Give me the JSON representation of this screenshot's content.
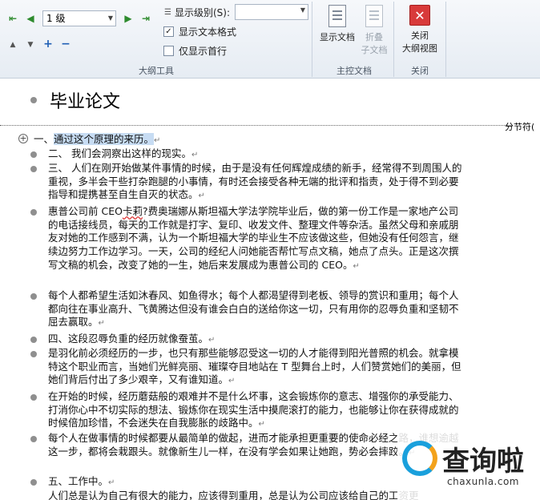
{
  "ribbon": {
    "outline_tools": {
      "group_label": "大纲工具",
      "level_select_value": "1 级",
      "show_level_label": "显示级别(S):",
      "show_text_format_label": "显示文本格式",
      "show_text_format_checked": true,
      "show_first_line_label": "仅显示首行",
      "show_first_line_checked": false
    },
    "master_document": {
      "group_label": "主控文档",
      "show_document_label": "显示文档",
      "collapse_subdoc_label_1": "折叠",
      "collapse_subdoc_label_2": "子文档"
    },
    "close": {
      "group_label": "关闭",
      "close_label_1": "关闭",
      "close_label_2": "大纲视图"
    }
  },
  "document": {
    "title": "毕业论文",
    "section_break_label": "分节符(",
    "paragraphs": [
      {
        "pre": "一、",
        "highlighted": "通过这个原理的来历。",
        "post": ""
      },
      {
        "text": "二、     我们会洞察出这样的现实。"
      },
      {
        "text": "三、     人们在刚开始做某件事情的时候，由于是没有任何辉煌成绩的新手，经常得不到周围人的重视，多半会干些打杂跑腿的小事情，有时还会接受各种无端的批评和指责，处于得不到必要指导和提携甚至自生自灭的状态。"
      },
      {
        "pre": "惠普公司前 CEO",
        "squiggle": "卡莉",
        "post": "?费奥瑞娜从斯坦福大学法学院毕业后，做的第一份工作是一家地产公司的电话接线员，每天的工作就是打字、复印、收发文件、整理文件等杂活。虽然父母和亲戚朋友对她的工作感到不满，认为一个斯坦福大学的毕业生不应该做这些，但她没有任何怨言，继续边努力工作边学习。一天，公司的经纪人问她能否帮忙写点文稿，她点了点头。正是这次撰写文稿的机会，改变了她的一生，她后来发展成为惠普公司的 CEO。"
      },
      {
        "text": "每个人都希望生活如沐春风、如鱼得水；每个人都渴望得到老板、领导的赏识和重用；每个人都向往在事业高升、飞黄腾达但没有谁会白白的送给你这一切，只有用你的忍辱负重和坚韧不屈去赢取。"
      },
      {
        "text": "四、这段忍辱负重的经历就像蚕茧。"
      },
      {
        "text": "是羽化前必须经历的一步，也只有那些能够忍受这一切的人才能得到阳光普照的机会。就拿模特这个职业而言，当她们光鲜亮丽、璀璨夺目地站在 T 型舞台上时，人们赞赏她们的美丽，但她们背后付出了多少艰辛，又有谁知道。"
      },
      {
        "text": "在开始的时候，经历蘑菇般的艰难并不是什么坏事，这会锻炼你的意志、增强你的承受能力、打消你心中不切实际的想法、锻炼你在现实生活中摸爬滚打的能力，也能够让你在获得成就的时候倍加珍惜，不会迷失在自我膨胀的歧路中。"
      },
      {
        "text": "每个人在做事情的时候都要从最简单的做起，进而才能承担更重要的使命必经之路，谁想逾越这一步，都将会栽跟头。就像新生儿一样，在没有学会如果让她跑，势必会摔跤。"
      },
      {
        "text": "五、工作中。"
      },
      {
        "text": "人们总是认为自己有很大的能力，应该得到重用，总是认为公司应该给自己的工资更"
      }
    ]
  },
  "watermark": {
    "name": "查询啦",
    "domain": "chaxunla.com"
  }
}
